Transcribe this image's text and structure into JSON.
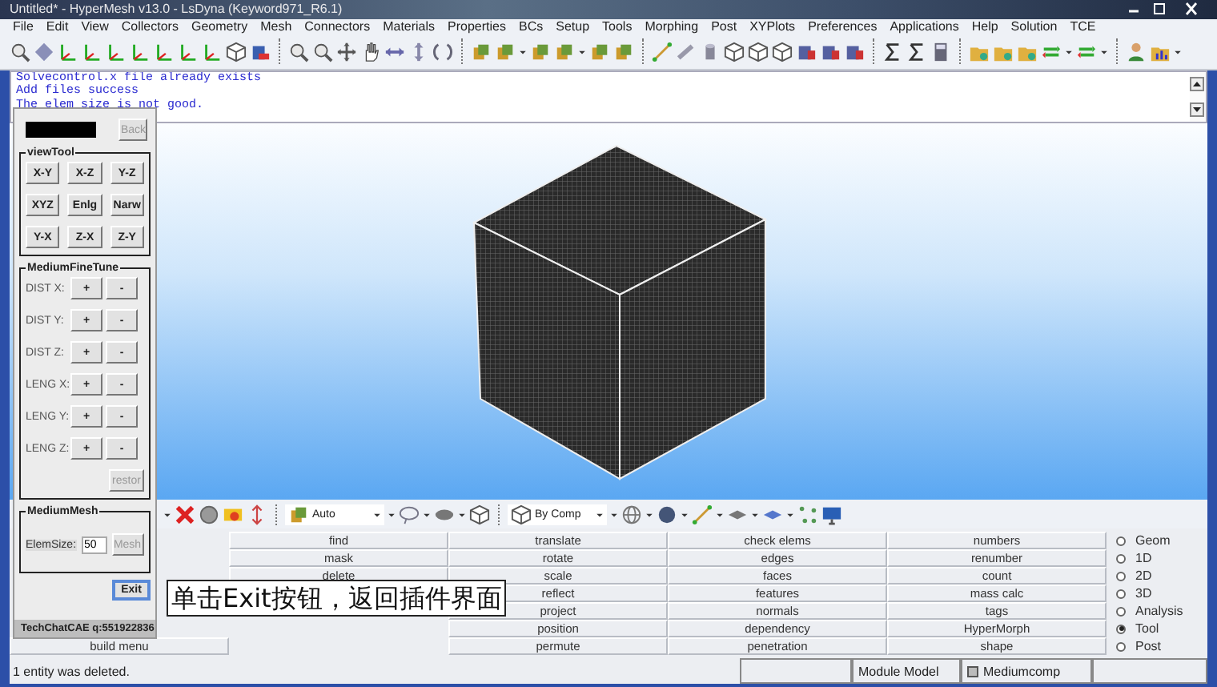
{
  "window": {
    "title": "Untitled* - HyperMesh v13.0 - LsDyna (Keyword971_R6.1)"
  },
  "menu_bar": [
    "File",
    "Edit",
    "View",
    "Collectors",
    "Geometry",
    "Mesh",
    "Connectors",
    "Materials",
    "Properties",
    "BCs",
    "Setup",
    "Tools",
    "Morphing",
    "Post",
    "XYPlots",
    "Preferences",
    "Applications",
    "Help",
    "Solution",
    "TCE"
  ],
  "command_log": [
    "Solvecontrol.x file already exists",
    "Add files success",
    "The elem size is not good."
  ],
  "plugin_panel": {
    "back_button": {
      "label": "Back",
      "disabled": true
    },
    "view_tool": {
      "title": "viewTool",
      "buttons": [
        "X-Y",
        "X-Z",
        "Y-Z",
        "XYZ",
        "Enlg",
        "Narw",
        "Y-X",
        "Z-X",
        "Z-Y"
      ]
    },
    "fine_tune": {
      "title": "MediumFineTune",
      "rows": [
        {
          "label": "DIST X:",
          "plus": "+",
          "minus": "-"
        },
        {
          "label": "DIST Y:",
          "plus": "+",
          "minus": "-"
        },
        {
          "label": "DIST Z:",
          "plus": "+",
          "minus": "-"
        },
        {
          "label": "LENG X:",
          "plus": "+",
          "minus": "-"
        },
        {
          "label": "LENG Y:",
          "plus": "+",
          "minus": "-"
        },
        {
          "label": "LENG Z:",
          "plus": "+",
          "minus": "-"
        }
      ],
      "restore_button": {
        "label": "restor",
        "disabled": true
      }
    },
    "mesh": {
      "title": "MediumMesh",
      "label": "ElemSize:",
      "value": "50",
      "mesh_button": {
        "label": "Mesh",
        "disabled": true
      }
    },
    "exit_button": {
      "label": "Exit"
    },
    "footer": "TechChatCAE q:551922836"
  },
  "display_toolbar": {
    "dropdowns": [
      "Auto",
      "By Comp"
    ]
  },
  "menu_columns": [
    [
      "build menu"
    ],
    [
      "find",
      "mask",
      "delete"
    ],
    [
      "translate",
      "rotate",
      "scale",
      "reflect",
      "project",
      "position",
      "permute"
    ],
    [
      "check elems",
      "edges",
      "faces",
      "features",
      "normals",
      "dependency",
      "penetration"
    ],
    [
      "numbers",
      "renumber",
      "count",
      "mass calc",
      "tags",
      "HyperMorph",
      "shape"
    ]
  ],
  "page_radios": [
    {
      "label": "Geom",
      "selected": false
    },
    {
      "label": "1D",
      "selected": false
    },
    {
      "label": "2D",
      "selected": false
    },
    {
      "label": "3D",
      "selected": false
    },
    {
      "label": "Analysis",
      "selected": false
    },
    {
      "label": "Tool",
      "selected": true
    },
    {
      "label": "Post",
      "selected": false
    }
  ],
  "status_bar": {
    "message": "1 entity was deleted.",
    "module": "Module Model",
    "component": "Mediumcomp"
  },
  "caption": "单击Exit按钮，返回插件界面"
}
